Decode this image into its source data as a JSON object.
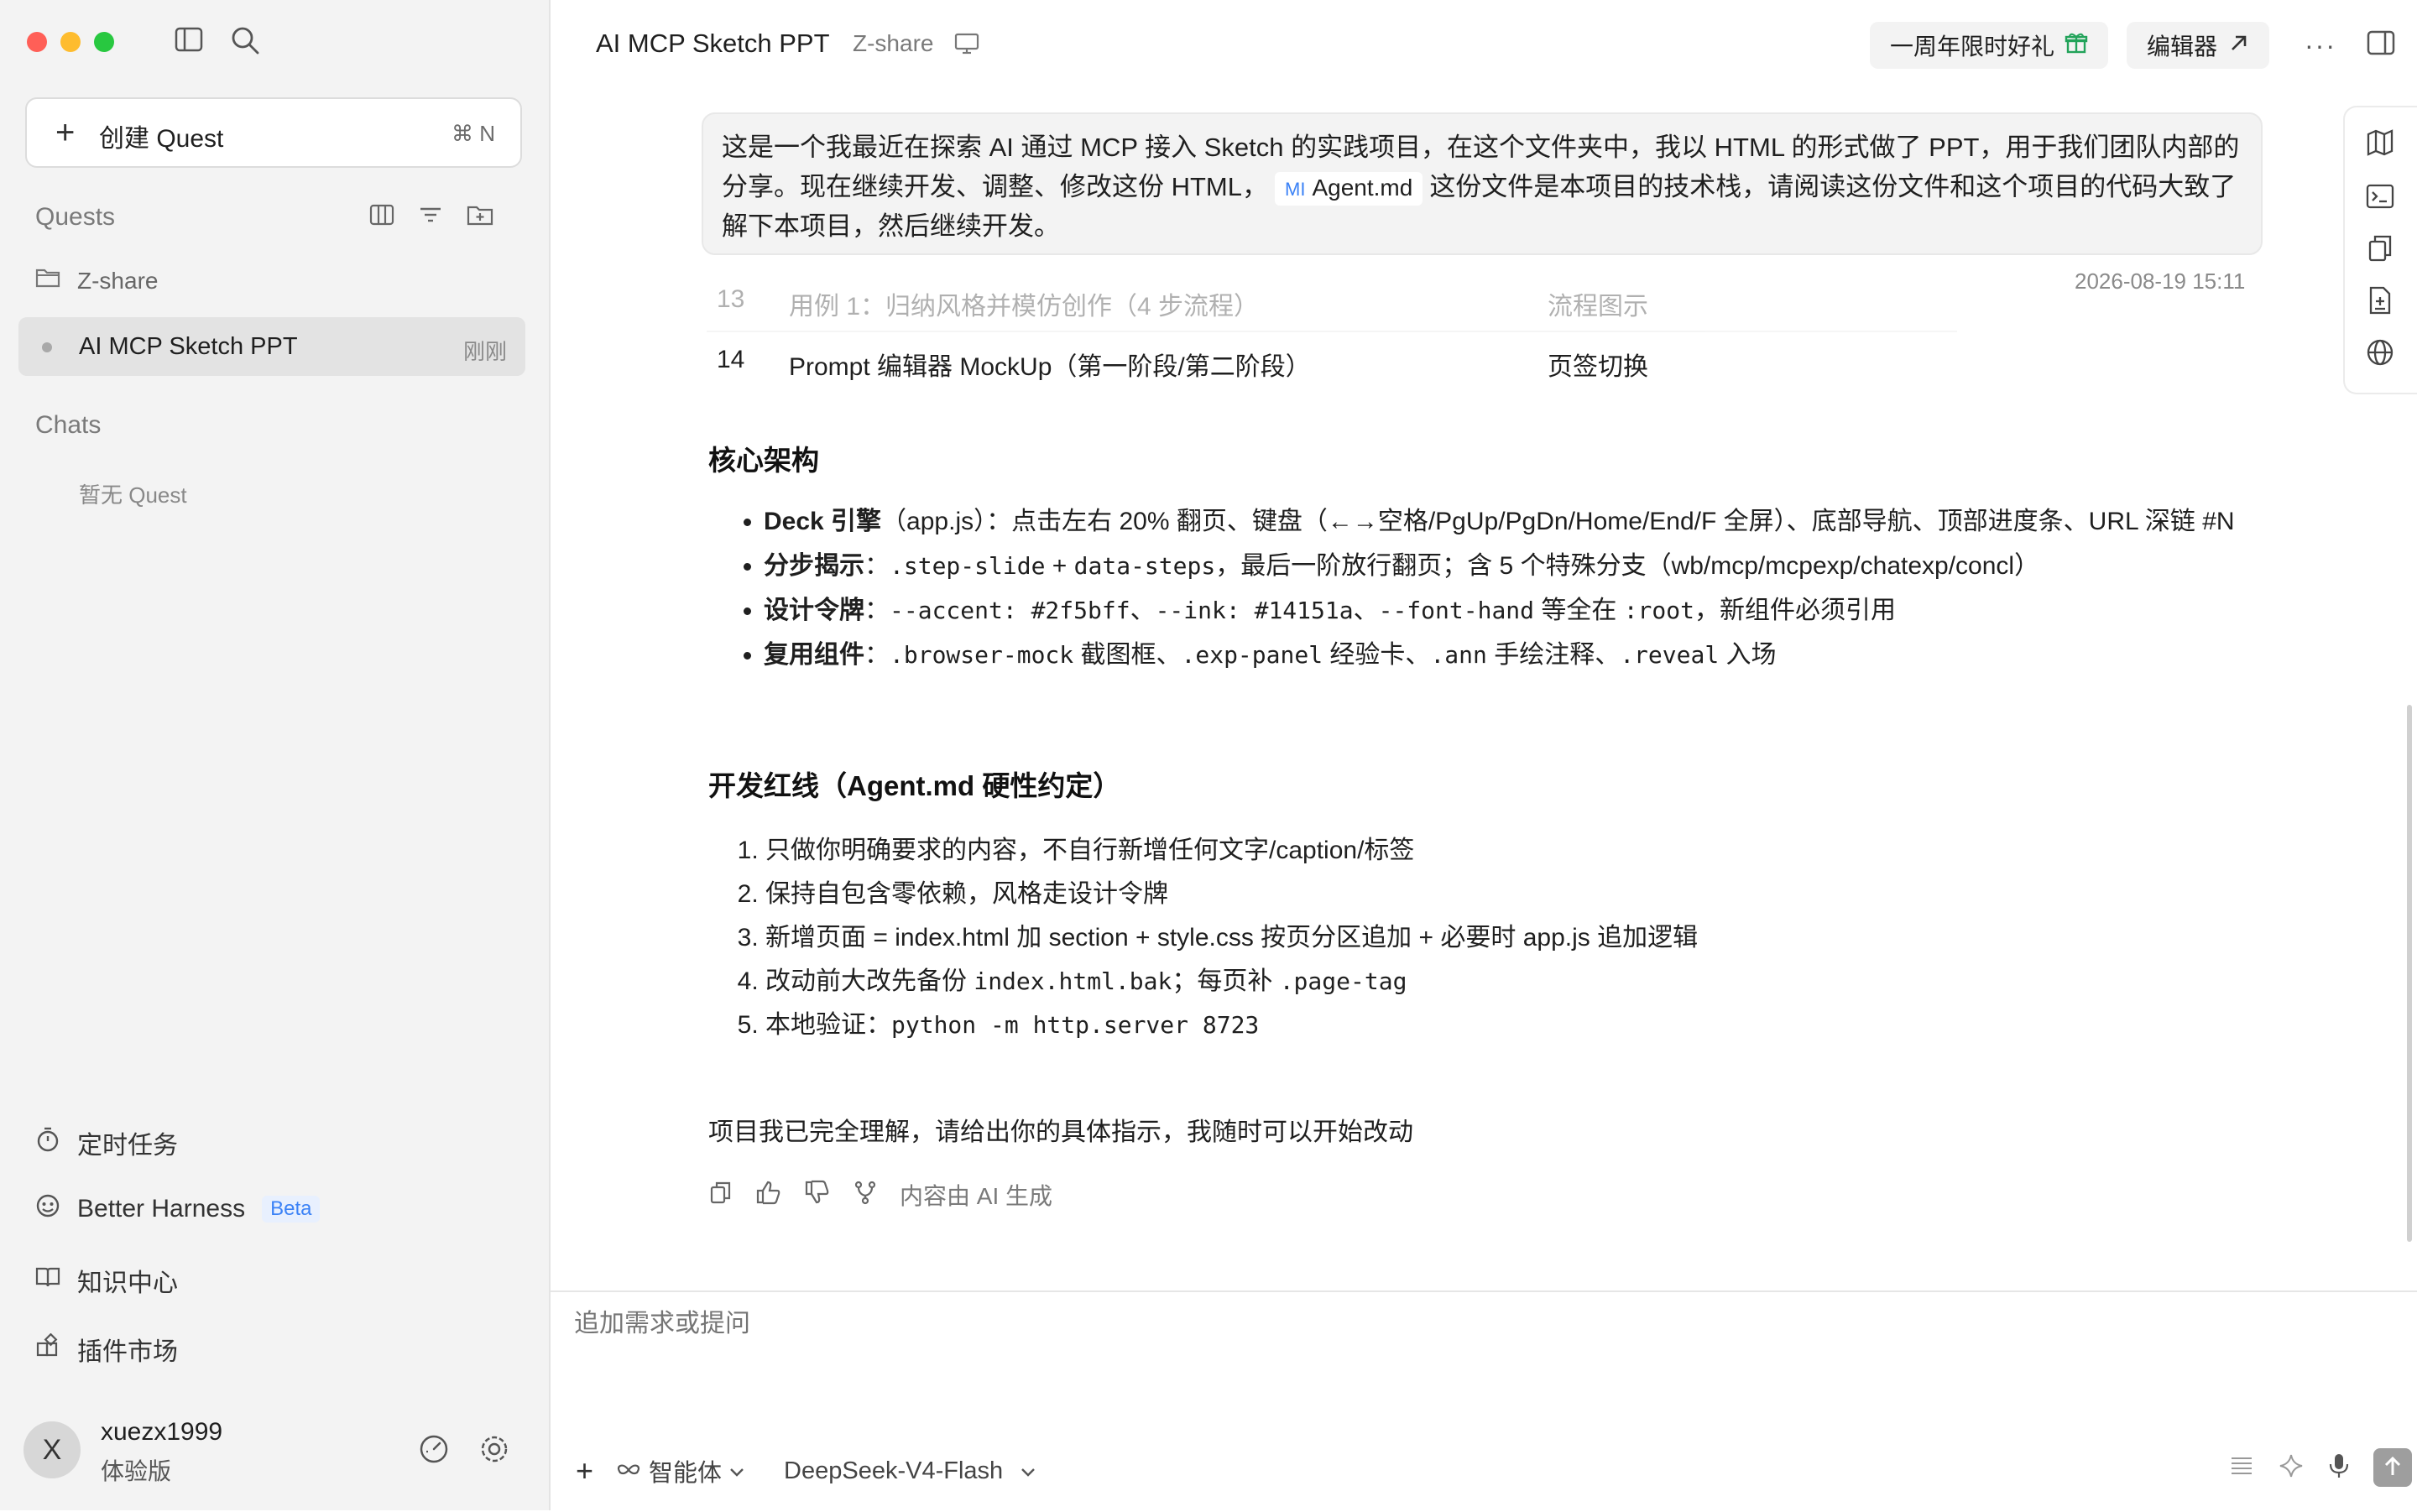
{
  "sidebar": {
    "new_quest": {
      "label": "创建 Quest",
      "shortcut": "⌘ N"
    },
    "quests_title": "Quests",
    "folder": "Z-share",
    "active_quest": {
      "label": "AI MCP Sketch PPT",
      "time": "刚刚"
    },
    "chats_title": "Chats",
    "chats_empty": "暂无 Quest",
    "nav": [
      {
        "label": "定时任务",
        "icon": "timer-icon"
      },
      {
        "label": "Better Harness",
        "badge": "Beta",
        "icon": "harness-icon"
      },
      {
        "label": "知识中心",
        "icon": "book-icon"
      },
      {
        "label": "插件市场",
        "icon": "plugin-icon"
      }
    ],
    "user": {
      "initial": "X",
      "name": "xuezx1999",
      "plan": "体验版"
    }
  },
  "header": {
    "title": "AI MCP Sketch PPT",
    "subtitle": "Z-share",
    "promo": "一周年限时好礼",
    "editor": "编辑器"
  },
  "message": {
    "part1": "这是一个我最近在探索 AI 通过 MCP 接入 Sketch 的实践项目，在这个文件夹中，我以 HTML 的形式做了 PPT，用于我们团队内部的分享。现在继续开发、调整、修改这份 HTML，",
    "file_icon": "MI",
    "file": "Agent.md",
    "part2": "这份文件是本项目的技术栈，请阅读这份文件和这个项目的代码大致了解下本项目，然后继续开发。",
    "time": "2026-08-19 15:11"
  },
  "table": {
    "faded": {
      "num": "13",
      "name": "用例 1：归纳风格并模仿创作（4 步流程）",
      "type": "流程图示"
    },
    "row": {
      "num": "14",
      "name": "Prompt 编辑器 MockUp（第一阶段/第二阶段）",
      "type": "页签切换"
    }
  },
  "architecture": {
    "title": "核心架构",
    "items": [
      {
        "bold": "Deck 引擎",
        "text": "（app.js）：点击左右 20% 翻页、键盘（←→空格/PgUp/PgDn/Home/End/F 全屏）、底部导航、顶部进度条、URL 深链 #N"
      },
      {
        "bold": "分步揭示",
        "text1": "：",
        "code1": ".step-slide",
        "text2": " + ",
        "code2": "data-steps",
        "text3": "，最后一阶放行翻页；含 5 个特殊分支（wb/mcp/mcpexp/chatexp/concl）"
      },
      {
        "bold": "设计令牌",
        "text1": "：",
        "code1": "--accent: #2f5bff",
        "text2": "、",
        "code2": "--ink: #14151a",
        "text3": "、",
        "code3": "--font-hand",
        "text4": " 等全在 ",
        "code4": ":root",
        "text5": "，新组件必须引用"
      },
      {
        "bold": "复用组件",
        "text1": "：",
        "code1": ".browser-mock",
        "text2": " 截图框、",
        "code2": ".exp-panel",
        "text3": " 经验卡、",
        "code3": ".ann",
        "text4": " 手绘注释、",
        "code4": ".reveal",
        "text5": " 入场"
      }
    ]
  },
  "redlines": {
    "title": "开发红线（Agent.md 硬性约定）",
    "items": [
      {
        "text": "只做你明确要求的内容，不自行新增任何文字/caption/标签"
      },
      {
        "text": "保持自包含零依赖，风格走设计令牌"
      },
      {
        "text": "新增页面 = index.html 加 section + style.css 按页分区追加 + 必要时 app.js 追加逻辑"
      },
      {
        "text1": "改动前大改先备份 ",
        "code1": "index.html.bak",
        "text2": "；每页补 ",
        "code2": ".page-tag"
      },
      {
        "text1": "本地验证：",
        "code1": "python -m http.server 8723"
      }
    ]
  },
  "closing": "项目我已完全理解，请给出你的具体指示，我随时可以开始改动",
  "ai_label": "内容由 AI 生成",
  "composer": {
    "placeholder": "追加需求或提问",
    "mode": "智能体",
    "model": "DeepSeek-V4-Flash"
  },
  "colors": {
    "accent": "#3b82f6",
    "sidebar_bg": "#f3f3f3",
    "selected_bg": "#e3e3e3"
  }
}
